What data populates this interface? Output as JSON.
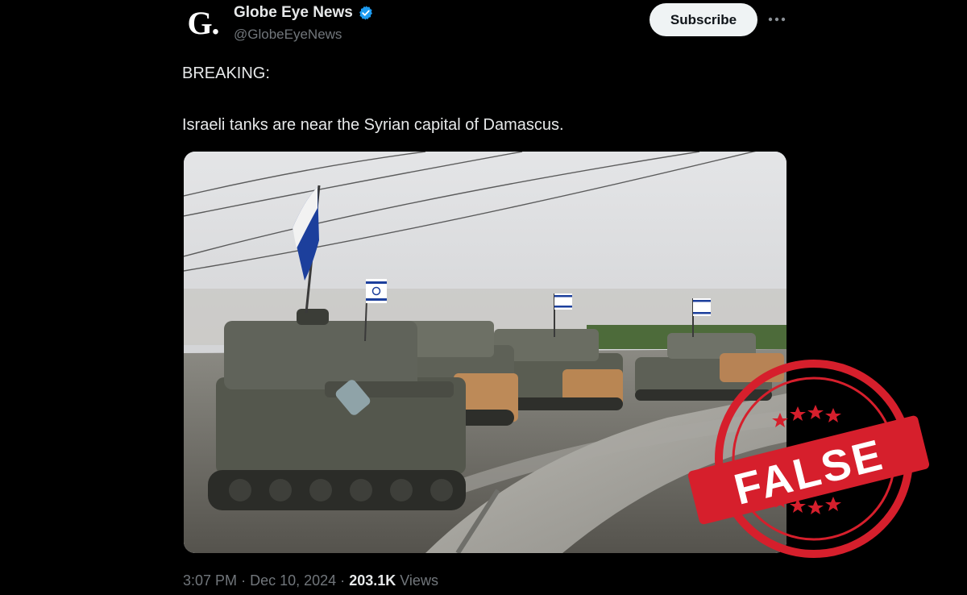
{
  "account": {
    "avatar_letter": "G.",
    "display_name": "Globe Eye News",
    "handle": "@GlobeEyeNews",
    "verified_color": "#1d9bf0"
  },
  "actions": {
    "subscribe_label": "Subscribe",
    "more_icon": "more-horizontal-icon"
  },
  "tweet": {
    "line_1": "BREAKING:",
    "line_2": "Israeli tanks are near the Syrian capital of Damascus.",
    "time": "3:07 PM",
    "separator": "·",
    "date": "Dec 10, 2024",
    "views_count": "203.1K",
    "views_label": "Views"
  },
  "stamp": {
    "text": "FALSE",
    "color": "#d61f2c"
  }
}
